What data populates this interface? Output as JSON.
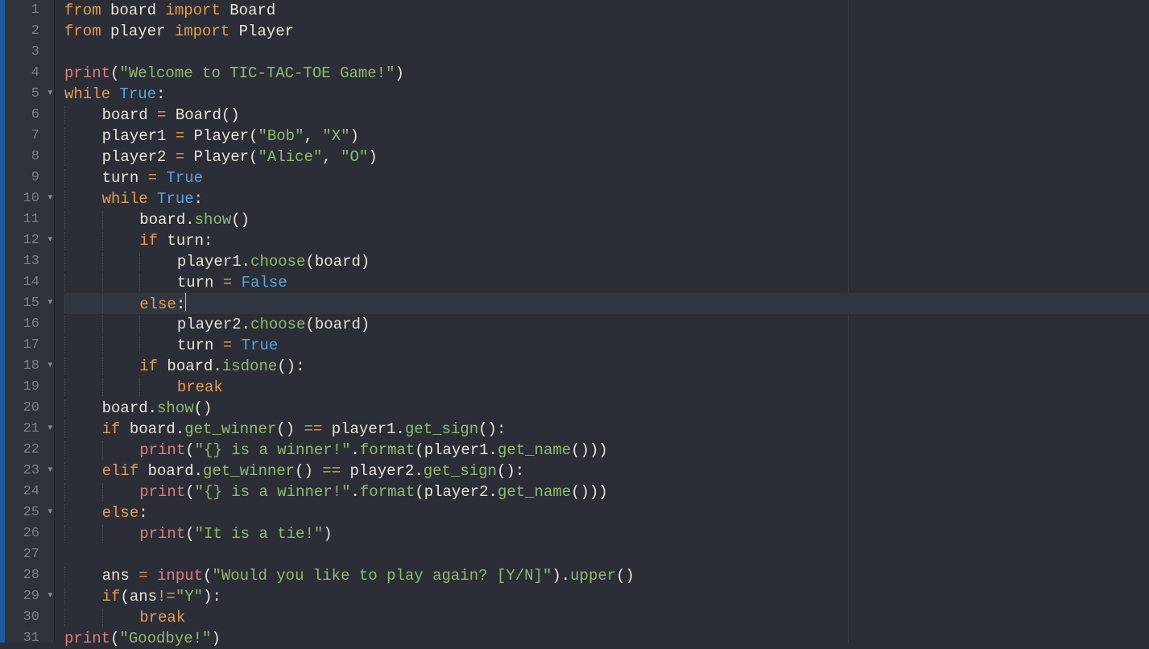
{
  "editor": {
    "lines": [
      {
        "n": 1,
        "fold": false,
        "active": false,
        "indent": "",
        "tokens": [
          [
            "kw",
            "from"
          ],
          [
            "ident",
            " board "
          ],
          [
            "kw",
            "import"
          ],
          [
            "ident",
            " Board"
          ]
        ]
      },
      {
        "n": 2,
        "fold": false,
        "active": false,
        "indent": "",
        "tokens": [
          [
            "kw",
            "from"
          ],
          [
            "ident",
            " player "
          ],
          [
            "kw",
            "import"
          ],
          [
            "ident",
            " Player"
          ]
        ]
      },
      {
        "n": 3,
        "fold": false,
        "active": false,
        "indent": "",
        "tokens": []
      },
      {
        "n": 4,
        "fold": false,
        "active": false,
        "indent": "",
        "tokens": [
          [
            "func",
            "print"
          ],
          [
            "punc",
            "("
          ],
          [
            "str",
            "\"Welcome to TIC-TAC-TOE Game!\""
          ],
          [
            "punc",
            ")"
          ]
        ]
      },
      {
        "n": 5,
        "fold": true,
        "active": false,
        "indent": "",
        "tokens": [
          [
            "kw",
            "while"
          ],
          [
            "ident",
            " "
          ],
          [
            "bool",
            "True"
          ],
          [
            "punc",
            ":"
          ]
        ]
      },
      {
        "n": 6,
        "fold": false,
        "active": false,
        "indent": "    ",
        "tokens": [
          [
            "ident",
            "board "
          ],
          [
            "op",
            "="
          ],
          [
            "ident",
            " Board"
          ],
          [
            "punc",
            "()"
          ]
        ]
      },
      {
        "n": 7,
        "fold": false,
        "active": false,
        "indent": "    ",
        "tokens": [
          [
            "ident",
            "player1 "
          ],
          [
            "op",
            "="
          ],
          [
            "ident",
            " Player"
          ],
          [
            "punc",
            "("
          ],
          [
            "str",
            "\"Bob\""
          ],
          [
            "punc",
            ", "
          ],
          [
            "str",
            "\"X\""
          ],
          [
            "punc",
            ")"
          ]
        ]
      },
      {
        "n": 8,
        "fold": false,
        "active": false,
        "indent": "    ",
        "tokens": [
          [
            "ident",
            "player2 "
          ],
          [
            "op",
            "="
          ],
          [
            "ident",
            " Player"
          ],
          [
            "punc",
            "("
          ],
          [
            "str",
            "\"Alice\""
          ],
          [
            "punc",
            ", "
          ],
          [
            "str",
            "\"O\""
          ],
          [
            "punc",
            ")"
          ]
        ]
      },
      {
        "n": 9,
        "fold": false,
        "active": false,
        "indent": "    ",
        "tokens": [
          [
            "ident",
            "turn "
          ],
          [
            "op",
            "="
          ],
          [
            "ident",
            " "
          ],
          [
            "bool",
            "True"
          ]
        ]
      },
      {
        "n": 10,
        "fold": true,
        "active": false,
        "indent": "    ",
        "tokens": [
          [
            "kw",
            "while"
          ],
          [
            "ident",
            " "
          ],
          [
            "bool",
            "True"
          ],
          [
            "punc",
            ":"
          ]
        ]
      },
      {
        "n": 11,
        "fold": false,
        "active": false,
        "indent": "        ",
        "tokens": [
          [
            "ident",
            "board."
          ],
          [
            "meth",
            "show"
          ],
          [
            "punc",
            "()"
          ]
        ]
      },
      {
        "n": 12,
        "fold": true,
        "active": false,
        "indent": "        ",
        "tokens": [
          [
            "kw",
            "if"
          ],
          [
            "ident",
            " turn"
          ],
          [
            "punc",
            ":"
          ]
        ]
      },
      {
        "n": 13,
        "fold": false,
        "active": false,
        "indent": "            ",
        "tokens": [
          [
            "ident",
            "player1."
          ],
          [
            "meth",
            "choose"
          ],
          [
            "punc",
            "(board)"
          ]
        ]
      },
      {
        "n": 14,
        "fold": false,
        "active": false,
        "indent": "            ",
        "tokens": [
          [
            "ident",
            "turn "
          ],
          [
            "op",
            "="
          ],
          [
            "ident",
            " "
          ],
          [
            "bool",
            "False"
          ]
        ]
      },
      {
        "n": 15,
        "fold": true,
        "active": true,
        "indent": "        ",
        "tokens": [
          [
            "kw",
            "else"
          ],
          [
            "punc",
            ":"
          ]
        ],
        "cursor": true
      },
      {
        "n": 16,
        "fold": false,
        "active": false,
        "indent": "            ",
        "tokens": [
          [
            "ident",
            "player2."
          ],
          [
            "meth",
            "choose"
          ],
          [
            "punc",
            "(board)"
          ]
        ]
      },
      {
        "n": 17,
        "fold": false,
        "active": false,
        "indent": "            ",
        "tokens": [
          [
            "ident",
            "turn "
          ],
          [
            "op",
            "="
          ],
          [
            "ident",
            " "
          ],
          [
            "bool",
            "True"
          ]
        ]
      },
      {
        "n": 18,
        "fold": true,
        "active": false,
        "indent": "        ",
        "tokens": [
          [
            "kw",
            "if"
          ],
          [
            "ident",
            " board."
          ],
          [
            "meth",
            "isdone"
          ],
          [
            "punc",
            "():"
          ]
        ]
      },
      {
        "n": 19,
        "fold": false,
        "active": false,
        "indent": "            ",
        "tokens": [
          [
            "kw",
            "break"
          ]
        ]
      },
      {
        "n": 20,
        "fold": false,
        "active": false,
        "indent": "    ",
        "tokens": [
          [
            "ident",
            "board."
          ],
          [
            "meth",
            "show"
          ],
          [
            "punc",
            "()"
          ]
        ]
      },
      {
        "n": 21,
        "fold": true,
        "active": false,
        "indent": "    ",
        "tokens": [
          [
            "kw",
            "if"
          ],
          [
            "ident",
            " board."
          ],
          [
            "meth",
            "get_winner"
          ],
          [
            "punc",
            "() "
          ],
          [
            "op",
            "=="
          ],
          [
            "ident",
            " player1."
          ],
          [
            "meth",
            "get_sign"
          ],
          [
            "punc",
            "():"
          ]
        ]
      },
      {
        "n": 22,
        "fold": false,
        "active": false,
        "indent": "        ",
        "tokens": [
          [
            "func",
            "print"
          ],
          [
            "punc",
            "("
          ],
          [
            "str",
            "\"{} is a winner!\""
          ],
          [
            "punc",
            "."
          ],
          [
            "meth",
            "format"
          ],
          [
            "punc",
            "(player1."
          ],
          [
            "meth",
            "get_name"
          ],
          [
            "punc",
            "()))"
          ]
        ]
      },
      {
        "n": 23,
        "fold": true,
        "active": false,
        "indent": "    ",
        "tokens": [
          [
            "kw",
            "elif"
          ],
          [
            "ident",
            " board."
          ],
          [
            "meth",
            "get_winner"
          ],
          [
            "punc",
            "() "
          ],
          [
            "op",
            "=="
          ],
          [
            "ident",
            " player2."
          ],
          [
            "meth",
            "get_sign"
          ],
          [
            "punc",
            "():"
          ]
        ]
      },
      {
        "n": 24,
        "fold": false,
        "active": false,
        "indent": "        ",
        "tokens": [
          [
            "func",
            "print"
          ],
          [
            "punc",
            "("
          ],
          [
            "str",
            "\"{} is a winner!\""
          ],
          [
            "punc",
            "."
          ],
          [
            "meth",
            "format"
          ],
          [
            "punc",
            "(player2."
          ],
          [
            "meth",
            "get_name"
          ],
          [
            "punc",
            "()))"
          ]
        ]
      },
      {
        "n": 25,
        "fold": true,
        "active": false,
        "indent": "    ",
        "tokens": [
          [
            "kw",
            "else"
          ],
          [
            "punc",
            ":"
          ]
        ]
      },
      {
        "n": 26,
        "fold": false,
        "active": false,
        "indent": "        ",
        "tokens": [
          [
            "func",
            "print"
          ],
          [
            "punc",
            "("
          ],
          [
            "str",
            "\"It is a tie!\""
          ],
          [
            "punc",
            ")"
          ]
        ]
      },
      {
        "n": 27,
        "fold": false,
        "active": false,
        "indent": "",
        "tokens": []
      },
      {
        "n": 28,
        "fold": false,
        "active": false,
        "indent": "    ",
        "tokens": [
          [
            "ident",
            "ans "
          ],
          [
            "op",
            "="
          ],
          [
            "ident",
            " "
          ],
          [
            "func",
            "input"
          ],
          [
            "punc",
            "("
          ],
          [
            "str",
            "\"Would you like to play again? [Y/N]\""
          ],
          [
            "punc",
            ")."
          ],
          [
            "meth",
            "upper"
          ],
          [
            "punc",
            "()"
          ]
        ]
      },
      {
        "n": 29,
        "fold": true,
        "active": false,
        "indent": "    ",
        "tokens": [
          [
            "kw",
            "if"
          ],
          [
            "punc",
            "(ans"
          ],
          [
            "op",
            "!="
          ],
          [
            "str",
            "\"Y\""
          ],
          [
            "punc",
            "):"
          ]
        ]
      },
      {
        "n": 30,
        "fold": false,
        "active": false,
        "indent": "        ",
        "tokens": [
          [
            "kw",
            "break"
          ]
        ]
      },
      {
        "n": 31,
        "fold": false,
        "active": false,
        "indent": "",
        "tokens": [
          [
            "func",
            "print"
          ],
          [
            "punc",
            "("
          ],
          [
            "str",
            "\"Goodbye!\""
          ],
          [
            "punc",
            ")"
          ]
        ]
      }
    ]
  }
}
